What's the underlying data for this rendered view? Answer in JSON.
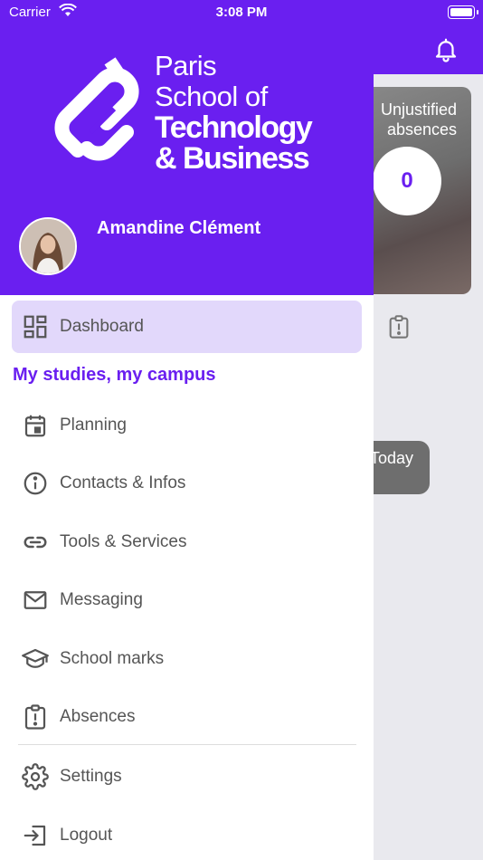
{
  "status_bar": {
    "carrier": "Carrier",
    "time": "3:08 PM"
  },
  "background": {
    "card_title_line1": "Unjustified",
    "card_title_line2": "absences",
    "counter": "0",
    "today_label": "Today"
  },
  "brand": {
    "line1": "Paris",
    "line2": "School of",
    "line3": "Technology",
    "line4": "& Business",
    "accent_color": "#6a1ff0"
  },
  "user": {
    "name": "Amandine Clément"
  },
  "menu": {
    "dashboard": "Dashboard",
    "section_title": "My studies, my campus",
    "items": [
      {
        "label": "Planning",
        "icon": "calendar-icon"
      },
      {
        "label": "Contacts & Infos",
        "icon": "info-icon"
      },
      {
        "label": "Tools & Services",
        "icon": "link-icon"
      },
      {
        "label": "Messaging",
        "icon": "mail-icon"
      },
      {
        "label": "School marks",
        "icon": "graduation-cap-icon"
      },
      {
        "label": "Absences",
        "icon": "clipboard-alert-icon"
      }
    ],
    "settings": "Settings",
    "logout": "Logout"
  }
}
